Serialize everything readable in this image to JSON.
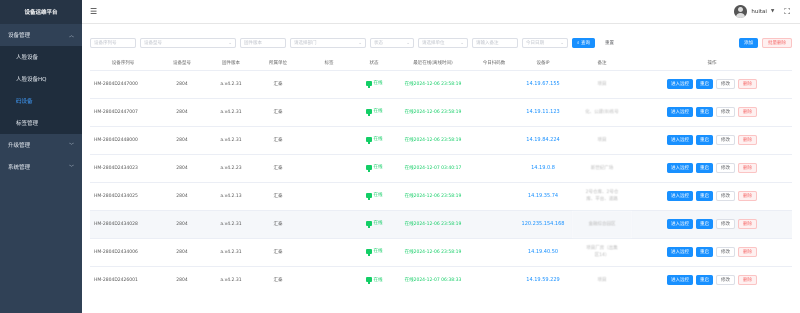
{
  "app": {
    "title": "设备运维平台"
  },
  "sidebar": {
    "groups": [
      {
        "label": "设备管理",
        "items": [
          "人脸设备",
          "人脸设备HQ",
          "码设备",
          "标签管理"
        ]
      },
      {
        "label": "升级管理"
      },
      {
        "label": "系统管理"
      }
    ]
  },
  "header": {
    "username": "huitai"
  },
  "filters": {
    "device_sn": "设备序列号",
    "device_model": "设备型号",
    "firmware": "固件版本",
    "dept": "请选择部门",
    "status": "状态",
    "owner": "请选择单位",
    "remark": "请输入备注",
    "date": "今日日期",
    "search": "查询",
    "reset": "重置",
    "add": "添加",
    "batch_delete": "批量删除"
  },
  "table": {
    "columns": [
      "设备序列号",
      "设备型号",
      "固件版本",
      "所属单位",
      "标签",
      "状态",
      "最近在线(离线时间)",
      "今日扫码数",
      "设备IP",
      "备注",
      "操作"
    ],
    "actions": {
      "remote": "进入远控",
      "restart": "重启",
      "edit": "修改",
      "delete": "删除"
    },
    "rows": [
      {
        "sn": "HM-2804D2447000",
        "model": "2804",
        "fw": "a.v4.2.31",
        "unit": "汇泰",
        "status": "在线",
        "last": "在线2024-12-06 23:58:19",
        "ip": "14.19.67.155",
        "remark": [
          "",
          "项目"
        ]
      },
      {
        "sn": "HM-2804D2447007",
        "model": "2804",
        "fw": "a.v4.2.31",
        "unit": "汇泰",
        "status": "在线",
        "last": "在线2024-12-06 23:58:19",
        "ip": "14.19.11.123",
        "remark": [
          "",
          "化、公建(B)栋号"
        ]
      },
      {
        "sn": "HM-2804D2448000",
        "model": "2804",
        "fw": "a.v4.2.31",
        "unit": "汇泰",
        "status": "在线",
        "last": "在线2024-12-06 23:58:19",
        "ip": "14.19.84.224",
        "remark": [
          "",
          "项目"
        ]
      },
      {
        "sn": "HM-2804D2434023",
        "model": "2804",
        "fw": "a.v4.2.23",
        "unit": "汇泰",
        "status": "在线",
        "last": "在线2024-12-07 03:40:17",
        "ip": "14.19.0.8",
        "remark": [
          "",
          "新世纪广场"
        ]
      },
      {
        "sn": "HM-2804D2434025",
        "model": "2804",
        "fw": "a.v4.2.13",
        "unit": "汇泰",
        "status": "在线",
        "last": "在线2024-12-06 23:58:19",
        "ip": "14.19.35.74",
        "remark": [
          "2号仓库、2号仓",
          "库、平台、道路"
        ]
      },
      {
        "sn": "HM-2804D2434028",
        "model": "2804",
        "fw": "a.v4.2.31",
        "unit": "汇泰",
        "status": "在线",
        "last": "在线2024-12-06 23:58:19",
        "ip": "120.235.154.168",
        "remark": [
          "",
          "金融综合园区"
        ]
      },
      {
        "sn": "HM-2804D2434006",
        "model": "2804",
        "fw": "a.v4.2.31",
        "unit": "汇泰",
        "status": "在线",
        "last": "在线2024-12-06 23:58:19",
        "ip": "14.19.40.50",
        "remark": [
          "项目厂房（出集",
          "区14）"
        ]
      },
      {
        "sn": "HM-2804D2426001",
        "model": "2804",
        "fw": "a.v4.2.31",
        "unit": "汇泰",
        "status": "在线",
        "last": "在线2024-12-07 06:38:33",
        "ip": "14.19.59.229",
        "remark": [
          "",
          "项目"
        ]
      }
    ]
  }
}
